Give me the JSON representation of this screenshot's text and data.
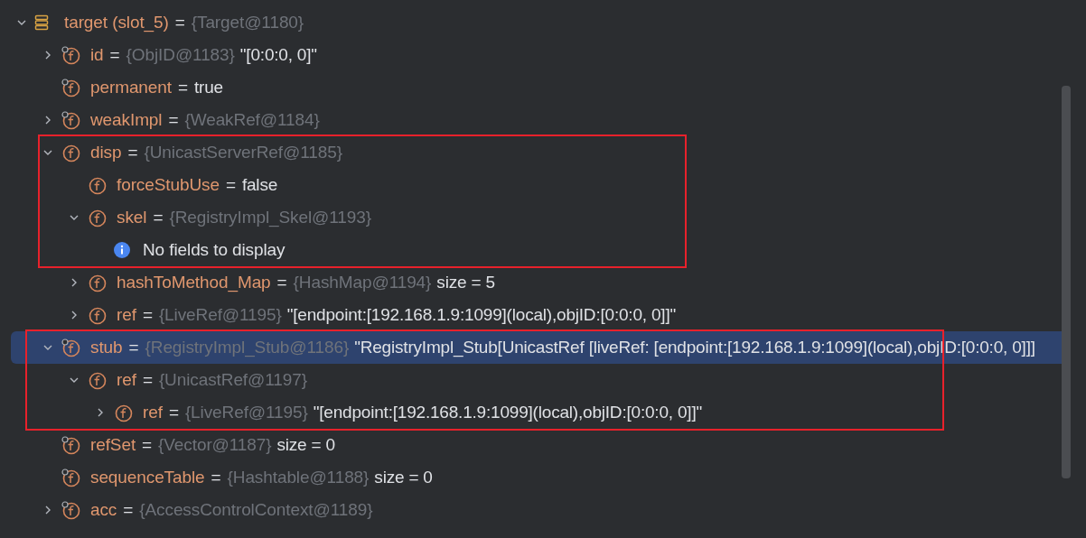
{
  "tree": [
    {
      "kind": "local",
      "name": "target (slot_5)",
      "sep": "=",
      "type": "{Target@1180}",
      "expanded": true,
      "selected": false,
      "highlighted": false,
      "children": [
        {
          "kind": "field",
          "marked": true,
          "name": "id",
          "sep": "=",
          "type": "{ObjID@1183}",
          "value": "\"[0:0:0, 0]\"",
          "expanded": false,
          "selected": false,
          "highlighted": false
        },
        {
          "kind": "field",
          "marked": true,
          "name": "permanent",
          "sep": "=",
          "value": "true",
          "selected": false,
          "highlighted": false
        },
        {
          "kind": "field",
          "marked": true,
          "name": "weakImpl",
          "sep": "=",
          "type": "{WeakRef@1184}",
          "expanded": false,
          "selected": false,
          "highlighted": false
        },
        {
          "kind": "field",
          "marked": false,
          "name": "disp",
          "sep": "=",
          "type": "{UnicastServerRef@1185}",
          "expanded": true,
          "selected": false,
          "highlighted": true,
          "children": [
            {
              "kind": "field",
              "marked": false,
              "name": "forceStubUse",
              "sep": "=",
              "value": "false",
              "selected": false,
              "highlighted": true
            },
            {
              "kind": "field",
              "marked": false,
              "name": "skel",
              "sep": "=",
              "type": "{RegistryImpl_Skel@1193}",
              "expanded": true,
              "selected": false,
              "highlighted": true,
              "children": [
                {
                  "kind": "info",
                  "name": "No fields to display",
                  "selected": false,
                  "highlighted": true
                }
              ]
            },
            {
              "kind": "field",
              "marked": false,
              "name": "hashToMethod_Map",
              "sep": "=",
              "type": "{HashMap@1194}",
              "value": "size = 5",
              "expanded": false,
              "selected": false,
              "highlighted": false
            },
            {
              "kind": "field",
              "marked": false,
              "name": "ref",
              "sep": "=",
              "type": "{LiveRef@1195}",
              "value": "\"[endpoint:[192.168.1.9:1099](local),objID:[0:0:0, 0]]\"",
              "expanded": false,
              "selected": false,
              "highlighted": false
            }
          ]
        },
        {
          "kind": "field",
          "marked": true,
          "name": "stub",
          "sep": "=",
          "type": "{RegistryImpl_Stub@1186}",
          "value": "\"RegistryImpl_Stub[UnicastRef [liveRef: [endpoint:[192.168.1.9:1099](local),objID:[0:0:0, 0]]]",
          "expanded": true,
          "selected": true,
          "highlighted": true,
          "children": [
            {
              "kind": "field",
              "marked": false,
              "name": "ref",
              "sep": "=",
              "type": "{UnicastRef@1197}",
              "expanded": true,
              "selected": false,
              "highlighted": true,
              "children": [
                {
                  "kind": "field",
                  "marked": false,
                  "name": "ref",
                  "sep": "=",
                  "type": "{LiveRef@1195}",
                  "value": "\"[endpoint:[192.168.1.9:1099](local),objID:[0:0:0, 0]]\"",
                  "expanded": false,
                  "selected": false,
                  "highlighted": true
                }
              ]
            }
          ]
        },
        {
          "kind": "field",
          "marked": true,
          "name": "refSet",
          "sep": "=",
          "type": "{Vector@1187}",
          "value": "size = 0",
          "selected": false,
          "highlighted": false
        },
        {
          "kind": "field",
          "marked": true,
          "name": "sequenceTable",
          "sep": "=",
          "type": "{Hashtable@1188}",
          "value": "size = 0",
          "selected": false,
          "highlighted": false
        },
        {
          "kind": "field",
          "marked": true,
          "name": "acc",
          "sep": "=",
          "type": "{AccessControlContext@1189}",
          "expanded": false,
          "selected": false,
          "highlighted": false
        }
      ]
    }
  ]
}
